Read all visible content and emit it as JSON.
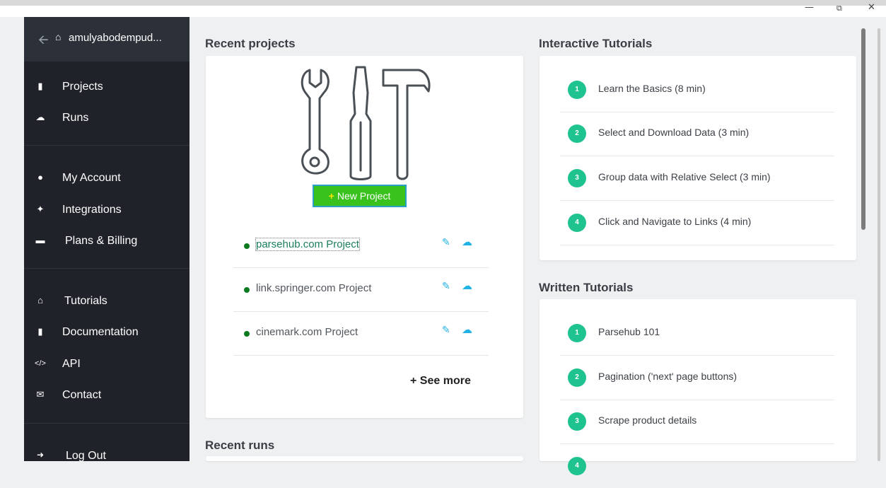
{
  "window": {
    "minimize": "—",
    "restore": "⧉",
    "close": "✕"
  },
  "sidebar": {
    "back_icon": "arrow-left-icon",
    "home_icon": "home-icon",
    "username": "amulyabodempud...",
    "items": [
      {
        "label": "Projects",
        "icon": "file-icon"
      },
      {
        "label": "Runs",
        "icon": "cloud-download-icon"
      },
      {
        "label": "My Account",
        "icon": "user-icon"
      },
      {
        "label": "Integrations",
        "icon": "plug-icon"
      },
      {
        "label": "Plans & Billing",
        "icon": "credit-card-icon"
      },
      {
        "label": "Tutorials",
        "icon": "institution-icon"
      },
      {
        "label": "Documentation",
        "icon": "book-icon"
      },
      {
        "label": "API",
        "icon": "code-icon"
      },
      {
        "label": "Contact",
        "icon": "envelope-icon"
      },
      {
        "label": "Log Out",
        "icon": "sign-out-icon"
      }
    ]
  },
  "recent_projects": {
    "title": "Recent projects",
    "new_project_label": "New Project",
    "projects": [
      {
        "name": "parsehub.com Project"
      },
      {
        "name": "link.springer.com Project"
      },
      {
        "name": "cinemark.com Project"
      }
    ],
    "see_more_label": "See more"
  },
  "recent_runs": {
    "title": "Recent runs"
  },
  "interactive_tutorials": {
    "title": "Interactive Tutorials",
    "items": [
      {
        "num": "1",
        "label": "Learn the Basics (8 min)"
      },
      {
        "num": "2",
        "label": "Select and Download Data (3 min)"
      },
      {
        "num": "3",
        "label": "Group data with Relative Select (3 min)"
      },
      {
        "num": "4",
        "label": "Click and Navigate to Links (4 min)"
      }
    ]
  },
  "written_tutorials": {
    "title": "Written Tutorials",
    "items": [
      {
        "num": "1",
        "label": "Parsehub 101"
      },
      {
        "num": "2",
        "label": "Pagination ('next' page buttons)"
      },
      {
        "num": "3",
        "label": "Scrape product details"
      },
      {
        "num": "4",
        "label": ""
      }
    ]
  },
  "colors": {
    "sidebar": "#1f2229",
    "accent_green": "#1fc38f",
    "button_green": "#39c21d",
    "link_blue": "#22b3e6"
  }
}
